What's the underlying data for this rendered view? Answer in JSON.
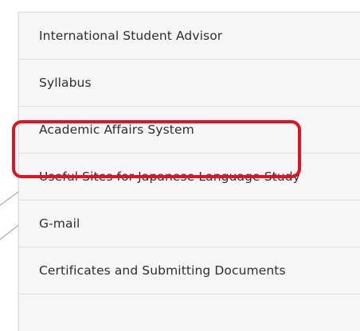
{
  "menu": {
    "items": [
      {
        "label": "International Student Advisor"
      },
      {
        "label": "Syllabus"
      },
      {
        "label": "Academic Affairs System"
      },
      {
        "label": "Useful Sites for Japanese Language Study"
      },
      {
        "label": "G-mail"
      },
      {
        "label": "Certificates and Submitting Documents"
      }
    ],
    "highlighted_item": "Academic Affairs System",
    "highlight_color": "#e0141e"
  }
}
